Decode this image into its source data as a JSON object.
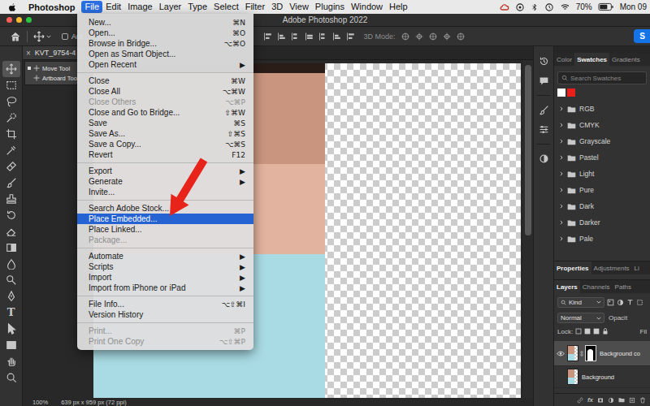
{
  "menu_bar": {
    "app_name": "Photoshop",
    "menus": [
      {
        "label": "File",
        "selected": true
      },
      {
        "label": "Edit",
        "selected": false
      },
      {
        "label": "Image",
        "selected": false
      },
      {
        "label": "Layer",
        "selected": false
      },
      {
        "label": "Type",
        "selected": false
      },
      {
        "label": "Select",
        "selected": false
      },
      {
        "label": "Filter",
        "selected": false
      },
      {
        "label": "3D",
        "selected": false
      },
      {
        "label": "View",
        "selected": false
      },
      {
        "label": "Plugins",
        "selected": false
      },
      {
        "label": "Window",
        "selected": false
      },
      {
        "label": "Help",
        "selected": false
      }
    ],
    "battery": "70%",
    "clock": "Mon 09"
  },
  "window": {
    "title": "Adobe Photoshop 2022"
  },
  "options_bar": {
    "auto_select_label": "Aut",
    "mode_label": "3D Mode:",
    "share_button": "S"
  },
  "toolbar": {
    "tools": [
      {
        "kind": "move",
        "selected": true
      },
      {
        "kind": "marquee",
        "selected": false
      },
      {
        "kind": "lasso",
        "selected": false
      },
      {
        "kind": "quick-select",
        "selected": false
      },
      {
        "kind": "crop",
        "selected": false
      },
      {
        "kind": "eyedropper",
        "selected": false
      },
      {
        "kind": "healing",
        "selected": false
      },
      {
        "kind": "brush",
        "selected": false
      },
      {
        "kind": "stamp",
        "selected": false
      },
      {
        "kind": "history",
        "selected": false
      },
      {
        "kind": "eraser",
        "selected": false
      },
      {
        "kind": "gradient",
        "selected": false
      },
      {
        "kind": "blur",
        "selected": false
      },
      {
        "kind": "dodge",
        "selected": false
      },
      {
        "kind": "pen",
        "selected": false
      },
      {
        "kind": "type",
        "label": "T",
        "selected": false
      },
      {
        "kind": "path-select",
        "selected": false
      },
      {
        "kind": "shape",
        "selected": false
      },
      {
        "kind": "hand",
        "selected": false
      },
      {
        "kind": "zoom",
        "selected": false
      }
    ]
  },
  "document": {
    "tab": "KVT_9754-4",
    "close": "×",
    "zoom": "100%",
    "size": "639 px x 959 px (72 ppi)"
  },
  "tool_flyout": [
    {
      "label": "Move Tool",
      "selected": true
    },
    {
      "label": "Artboard Too",
      "selected": false
    }
  ],
  "file_menu": {
    "groups": [
      [
        {
          "label": "New...",
          "shortcut": "⌘N",
          "disabled": false,
          "selected": false
        },
        {
          "label": "Open...",
          "shortcut": "⌘O",
          "disabled": false,
          "selected": false
        },
        {
          "label": "Browse in Bridge...",
          "shortcut": "⌥⌘O",
          "disabled": false,
          "selected": false
        },
        {
          "label": "Open as Smart Object...",
          "disabled": false,
          "selected": false
        },
        {
          "label": "Open Recent",
          "shortcut": "▶",
          "disabled": false,
          "selected": false
        }
      ],
      [
        {
          "label": "Close",
          "shortcut": "⌘W",
          "disabled": false,
          "selected": false
        },
        {
          "label": "Close All",
          "shortcut": "⌥⌘W",
          "disabled": false,
          "selected": false
        },
        {
          "label": "Close Others",
          "shortcut": "⌥⌘P",
          "disabled": true,
          "selected": false
        },
        {
          "label": "Close and Go to Bridge...",
          "shortcut": "⇧⌘W",
          "disabled": false,
          "selected": false
        },
        {
          "label": "Save",
          "shortcut": "⌘S",
          "disabled": false,
          "selected": false
        },
        {
          "label": "Save As...",
          "shortcut": "⇧⌘S",
          "disabled": false,
          "selected": false
        },
        {
          "label": "Save a Copy...",
          "shortcut": "⌥⌘S",
          "disabled": false,
          "selected": false
        },
        {
          "label": "Revert",
          "shortcut": "F12",
          "disabled": false,
          "selected": false
        }
      ],
      [
        {
          "label": "Export",
          "shortcut": "▶",
          "disabled": false,
          "selected": false
        },
        {
          "label": "Generate",
          "shortcut": "▶",
          "disabled": false,
          "selected": false
        },
        {
          "label": "Invite...",
          "disabled": false,
          "selected": false
        }
      ],
      [
        {
          "label": "Search Adobe Stock...",
          "disabled": false,
          "selected": false
        },
        {
          "label": "Place Embedded...",
          "disabled": false,
          "selected": true
        },
        {
          "label": "Place Linked...",
          "disabled": false,
          "selected": false
        },
        {
          "label": "Package...",
          "disabled": true,
          "selected": false
        }
      ],
      [
        {
          "label": "Automate",
          "shortcut": "▶",
          "disabled": false,
          "selected": false
        },
        {
          "label": "Scripts",
          "shortcut": "▶",
          "disabled": false,
          "selected": false
        },
        {
          "label": "Import",
          "shortcut": "▶",
          "disabled": false,
          "selected": false
        },
        {
          "label": "Import from iPhone or iPad",
          "shortcut": "▶",
          "disabled": false,
          "selected": false
        }
      ],
      [
        {
          "label": "File Info...",
          "shortcut": "⌥⇧⌘I",
          "disabled": false,
          "selected": false
        },
        {
          "label": "Version History",
          "disabled": false,
          "selected": false
        }
      ],
      [
        {
          "label": "Print...",
          "shortcut": "⌘P",
          "disabled": true,
          "selected": false
        },
        {
          "label": "Print One Copy",
          "shortcut": "⌥⇧⌘P",
          "disabled": true,
          "selected": false
        }
      ]
    ]
  },
  "swatches_panel": {
    "tabs": [
      {
        "label": "Color",
        "selected": false
      },
      {
        "label": "Swatches",
        "selected": true
      },
      {
        "label": "Gradients",
        "selected": false
      }
    ],
    "search_placeholder": "Search Swatches",
    "recent_colors": [
      {
        "color": "#ffffff"
      },
      {
        "color": "#e8201c"
      }
    ],
    "groups": [
      {
        "label": "RGB",
        "expanded": false
      },
      {
        "label": "CMYK",
        "expanded": false
      },
      {
        "label": "Grayscale",
        "expanded": false
      },
      {
        "label": "Pastel",
        "expanded": false
      },
      {
        "label": "Light",
        "expanded": false
      },
      {
        "label": "Pure",
        "expanded": false
      },
      {
        "label": "Dark",
        "expanded": false
      },
      {
        "label": "Darker",
        "expanded": false
      },
      {
        "label": "Pale",
        "expanded": false
      }
    ]
  },
  "properties_tabs": [
    {
      "label": "Properties",
      "selected": true
    },
    {
      "label": "Adjustments",
      "selected": false
    },
    {
      "label": "Li",
      "selected": false
    }
  ],
  "layers_panel": {
    "tabs": [
      {
        "label": "Layers",
        "selected": true
      },
      {
        "label": "Channels",
        "selected": false
      },
      {
        "label": "Paths",
        "selected": false
      }
    ],
    "filter": "Kind",
    "blend_mode": "Normal",
    "opacity_label": "Opacit",
    "lock_label": "Lock:",
    "fill_label": "Fil",
    "layers": [
      {
        "name": "Background co",
        "visible": true,
        "selected": true,
        "has_mask": true
      },
      {
        "name": "Background",
        "visible": false,
        "selected": false,
        "has_mask": false
      }
    ],
    "footer_label": "fx"
  }
}
